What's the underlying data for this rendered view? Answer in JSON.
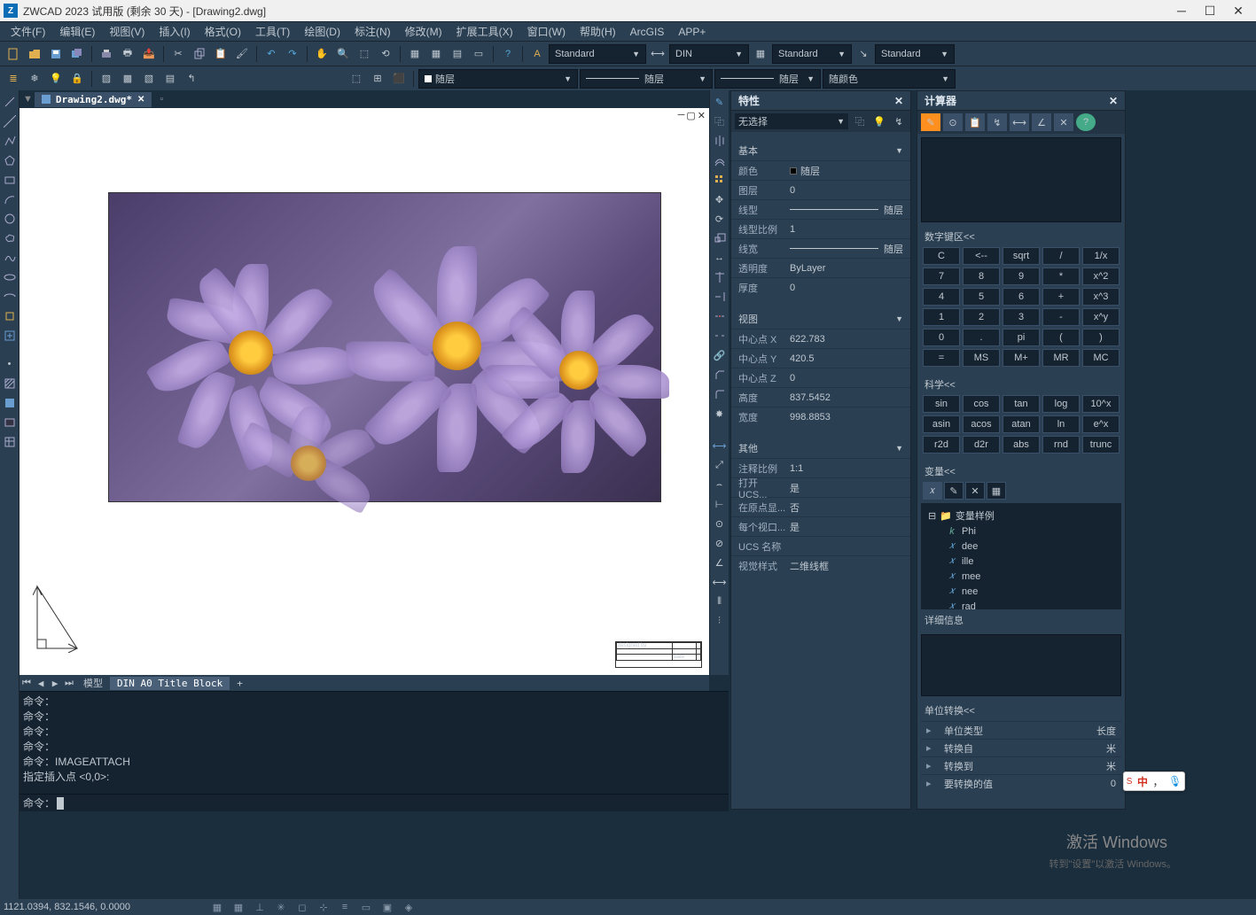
{
  "app": {
    "title": "ZWCAD 2023 试用版 (剩余 30 天) - [Drawing2.dwg]",
    "logo_text": "Z"
  },
  "menu": [
    "文件(F)",
    "编辑(E)",
    "视图(V)",
    "插入(I)",
    "格式(O)",
    "工具(T)",
    "绘图(D)",
    "标注(N)",
    "修改(M)",
    "扩展工具(X)",
    "窗口(W)",
    "帮助(H)",
    "ArcGIS",
    "APP+"
  ],
  "style_combos": {
    "text_style": "Standard",
    "dim_style": "DIN",
    "table_style": "Standard",
    "mleader_style": "Standard"
  },
  "layer_combos": {
    "layer": "随层",
    "linetype": "随层",
    "lineweight": "随层",
    "color": "随颜色"
  },
  "doc_tab": {
    "name": "Drawing2.dwg*"
  },
  "layout_tabs": {
    "model": "模型",
    "layout1": "DIN A0 Title Block",
    "new": "+"
  },
  "title_block": {
    "designed_by": "designed by",
    "date": "date"
  },
  "command_history": [
    "命令：",
    "命令：",
    "命令：",
    "命令：",
    "命令：IMAGEATTACH",
    "指定插入点 <0,0>:"
  ],
  "command_prompt": "命令：",
  "status": {
    "coords": "1121.0394, 832.1546, 0.0000"
  },
  "properties": {
    "title": "特性",
    "selection": "无选择",
    "sections": {
      "basic": {
        "head": "基本",
        "rows": {
          "color": {
            "k": "颜色",
            "v": "随层"
          },
          "layer": {
            "k": "图层",
            "v": "0"
          },
          "linetype": {
            "k": "线型",
            "v": "随层"
          },
          "ltscale": {
            "k": "线型比例",
            "v": "1"
          },
          "lineweight": {
            "k": "线宽",
            "v": "随层"
          },
          "transparency": {
            "k": "透明度",
            "v": "ByLayer"
          },
          "thickness": {
            "k": "厚度",
            "v": "0"
          }
        }
      },
      "view": {
        "head": "视图",
        "rows": {
          "cx": {
            "k": "中心点 X",
            "v": "622.783"
          },
          "cy": {
            "k": "中心点 Y",
            "v": "420.5"
          },
          "cz": {
            "k": "中心点 Z",
            "v": "0"
          },
          "height": {
            "k": "高度",
            "v": "837.5452"
          },
          "width": {
            "k": "宽度",
            "v": "998.8853"
          }
        }
      },
      "other": {
        "head": "其他",
        "rows": {
          "anno": {
            "k": "注释比例",
            "v": "1:1"
          },
          "ucs_on": {
            "k": "打开 UCS...",
            "v": "是"
          },
          "origin": {
            "k": "在原点显...",
            "v": "否"
          },
          "viewport": {
            "k": "每个视口...",
            "v": "是"
          },
          "ucs_name": {
            "k": "UCS 名称",
            "v": ""
          },
          "visual": {
            "k": "视觉样式",
            "v": "二维线框"
          }
        }
      }
    }
  },
  "calculator": {
    "title": "计算器",
    "numpad_head": "数字键区<<",
    "numpad": [
      [
        "C",
        "<--",
        "sqrt",
        "/",
        "1/x"
      ],
      [
        "7",
        "8",
        "9",
        "*",
        "x^2"
      ],
      [
        "4",
        "5",
        "6",
        "+",
        "x^3"
      ],
      [
        "1",
        "2",
        "3",
        "-",
        "x^y"
      ],
      [
        "0",
        ".",
        "pi",
        "(",
        ")"
      ],
      [
        "=",
        "MS",
        "M+",
        "MR",
        "MC"
      ]
    ],
    "sci_head": "科学<<",
    "sci": [
      [
        "sin",
        "cos",
        "tan",
        "log",
        "10^x"
      ],
      [
        "asin",
        "acos",
        "atan",
        "ln",
        "e^x"
      ],
      [
        "r2d",
        "d2r",
        "abs",
        "rnd",
        "trunc"
      ]
    ],
    "var_head": "变量<<",
    "var_folder": "变量样例",
    "vars": [
      "Phi",
      "dee",
      "ille",
      "mee",
      "nee",
      "rad"
    ],
    "detail_head": "详细信息",
    "unit_head": "单位转换<<",
    "unit_rows": {
      "type": {
        "k": "单位类型",
        "v": "长度"
      },
      "from": {
        "k": "转换自",
        "v": "米"
      },
      "to": {
        "k": "转换到",
        "v": "米"
      },
      "val": {
        "k": "要转换的值",
        "v": "0"
      }
    }
  },
  "watermark": {
    "line1": "激活 Windows",
    "line2": "转到\"设置\"以激活 Windows。"
  },
  "ime": {
    "zh": "中",
    "comma": "，",
    "mic": "🎤"
  }
}
